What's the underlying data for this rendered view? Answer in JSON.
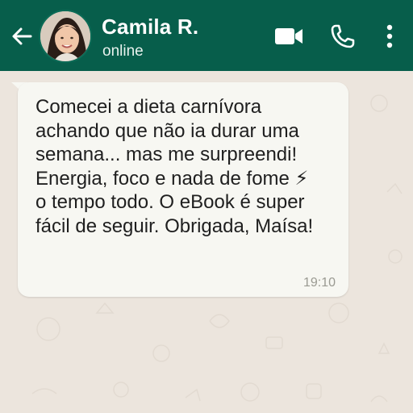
{
  "header": {
    "contact_name": "Camila R.",
    "status": "online",
    "back_icon": "arrow-left-icon",
    "video_icon": "video-camera-icon",
    "call_icon": "phone-icon",
    "menu_icon": "more-vertical-icon"
  },
  "message": {
    "text": "Comecei a dieta carnívora\nachando que não ia durar uma\nsemana... mas me surpreendi!\nEnergia, foco e nada de fome ⚡\no tempo todo. O eBook é super\nfácil de seguir. Obrigada, Maísa!",
    "time": "19:10"
  },
  "colors": {
    "header_bg": "#075e4b",
    "chat_bg": "#ece5dd",
    "bubble_bg": "#f7f7f2",
    "timestamp": "#9a9a92"
  }
}
